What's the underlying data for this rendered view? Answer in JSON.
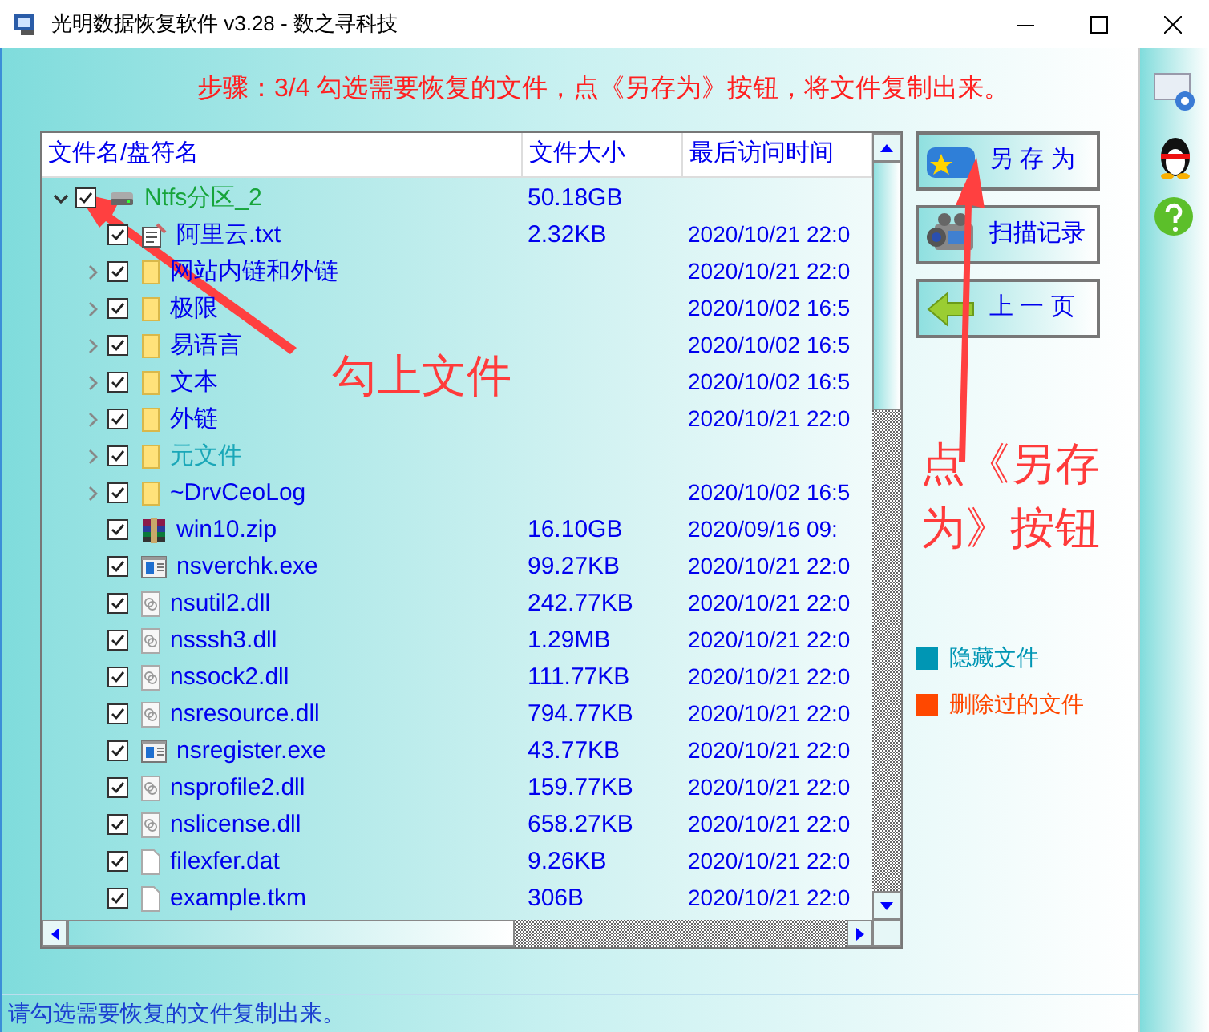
{
  "window": {
    "title": "光明数据恢复软件 v3.28 - 数之寻科技"
  },
  "step": "步骤：3/4 勾选需要恢复的文件，点《另存为》按钮，将文件复制出来。",
  "tree": {
    "columns": [
      "文件名/盘符名",
      "文件大小",
      "最后访问时间"
    ],
    "rows": [
      {
        "kind": "drive",
        "name": "Ntfs分区_2",
        "size": "50.18GB",
        "checked": true,
        "expanded": true,
        "children": [
          {
            "kind": "txt",
            "name": "阿里云.txt",
            "size": "2.32KB",
            "date": "2020/10/21 22:0",
            "checked": true,
            "hidden": false
          },
          {
            "kind": "folder",
            "name": "网站内链和外链",
            "date": "2020/10/21 22:0",
            "checked": true,
            "hidden": false,
            "expanded": false
          },
          {
            "kind": "folder",
            "name": "极限",
            "date": "2020/10/02 16:5",
            "checked": true,
            "hidden": false,
            "expanded": false
          },
          {
            "kind": "folder",
            "name": "易语言",
            "date": "2020/10/02 16:5",
            "checked": true,
            "hidden": false,
            "expanded": false
          },
          {
            "kind": "folder",
            "name": "文本",
            "date": "2020/10/02 16:5",
            "checked": true,
            "hidden": false,
            "expanded": false
          },
          {
            "kind": "folder",
            "name": "外链",
            "date": "2020/10/21 22:0",
            "checked": true,
            "hidden": false,
            "expanded": false
          },
          {
            "kind": "folder",
            "name": "元文件",
            "checked": true,
            "hidden": true,
            "expanded": false
          },
          {
            "kind": "folder",
            "name": "~DrvCeoLog",
            "date": "2020/10/02 16:5",
            "checked": true,
            "hidden": false,
            "expanded": false
          },
          {
            "kind": "zip",
            "name": "win10.zip",
            "size": "16.10GB",
            "date": "2020/09/16 09:",
            "checked": true,
            "hidden": false
          },
          {
            "kind": "exe",
            "name": "nsverchk.exe",
            "size": "99.27KB",
            "date": "2020/10/21 22:0",
            "checked": true,
            "hidden": false
          },
          {
            "kind": "dll",
            "name": "nsutil2.dll",
            "size": "242.77KB",
            "date": "2020/10/21 22:0",
            "checked": true,
            "hidden": false
          },
          {
            "kind": "dll",
            "name": "nsssh3.dll",
            "size": "1.29MB",
            "date": "2020/10/21 22:0",
            "checked": true,
            "hidden": false
          },
          {
            "kind": "dll",
            "name": "nssock2.dll",
            "size": "111.77KB",
            "date": "2020/10/21 22:0",
            "checked": true,
            "hidden": false
          },
          {
            "kind": "dll",
            "name": "nsresource.dll",
            "size": "794.77KB",
            "date": "2020/10/21 22:0",
            "checked": true,
            "hidden": false
          },
          {
            "kind": "exe",
            "name": "nsregister.exe",
            "size": "43.77KB",
            "date": "2020/10/21 22:0",
            "checked": true,
            "hidden": false
          },
          {
            "kind": "dll",
            "name": "nsprofile2.dll",
            "size": "159.77KB",
            "date": "2020/10/21 22:0",
            "checked": true,
            "hidden": false
          },
          {
            "kind": "dll",
            "name": "nslicense.dll",
            "size": "658.27KB",
            "date": "2020/10/21 22:0",
            "checked": true,
            "hidden": false
          },
          {
            "kind": "file",
            "name": "filexfer.dat",
            "size": "9.26KB",
            "date": "2020/10/21 22:0",
            "checked": true,
            "hidden": false
          },
          {
            "kind": "file",
            "name": "example.tkm",
            "size": "306B",
            "date": "2020/10/21 22:0",
            "checked": true,
            "hidden": false
          }
        ]
      }
    ]
  },
  "buttons": [
    {
      "kind": "save",
      "label": "另 存 为"
    },
    {
      "kind": "records",
      "label": "扫描记录"
    },
    {
      "kind": "back",
      "label": "上 一 页"
    }
  ],
  "legend": [
    {
      "label": "隐藏文件",
      "color": "#0096b4"
    },
    {
      "label": "删除过的文件",
      "color": "#ff4800"
    }
  ],
  "status_bar": "请勾选需要恢复的文件复制出来。",
  "annotations": [
    {
      "text": "勾上文件"
    },
    {
      "text": "点《另存为》按钮"
    }
  ]
}
